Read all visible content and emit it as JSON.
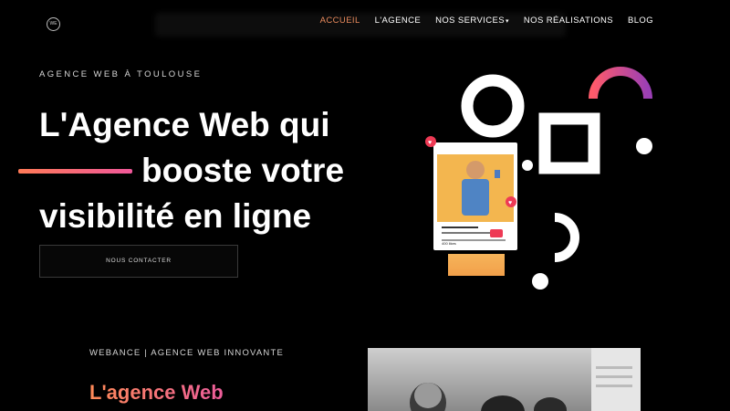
{
  "nav": {
    "logo_text": "WE",
    "items": [
      {
        "label": "ACCUEIL",
        "active": true
      },
      {
        "label": "L'AGENCE",
        "active": false
      },
      {
        "label": "NOS SERVICES",
        "active": false,
        "has_dropdown": true
      },
      {
        "label": "NOS RÉALISATIONS",
        "active": false
      },
      {
        "label": "BLOG",
        "active": false
      }
    ],
    "active_color": "#e98a5c"
  },
  "hero": {
    "kicker": "AGENCE WEB À TOULOUSE",
    "title_line1": "L'Agence Web qui",
    "title_line2": "booste votre",
    "title_line3": "visibilité en ligne",
    "cta_label": "NOUS CONTACTER",
    "accent_gradient": [
      "#ff7a57",
      "#f0589a"
    ]
  },
  "illustration": {
    "post_likes": "400 likes",
    "post_caption": "username    on #brand"
  },
  "section2": {
    "kicker": "WEBANCE | AGENCE WEB INNOVANTE",
    "title": "L'agence Web"
  }
}
